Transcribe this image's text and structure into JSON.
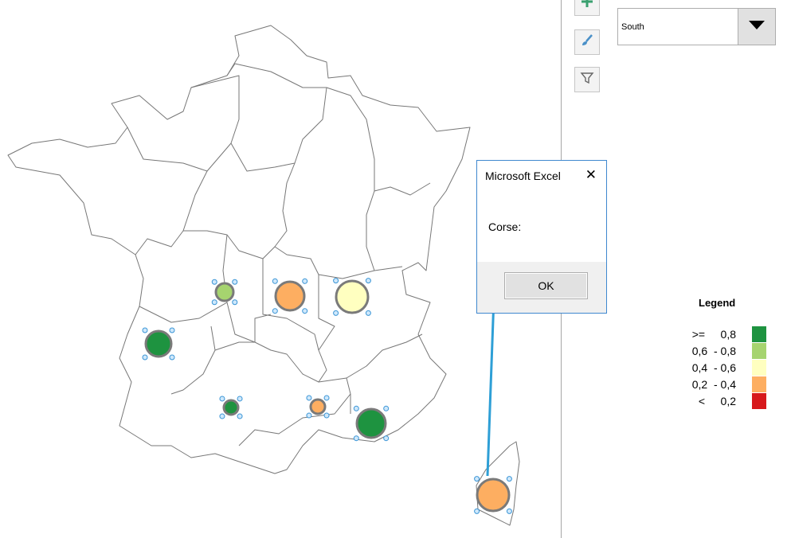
{
  "dropdown": {
    "selected": "South"
  },
  "toolbar": {
    "add": "plus-icon",
    "format": "paintbrush-icon",
    "filter": "filter-icon"
  },
  "dialog": {
    "title": "Microsoft Excel",
    "message": "Corse:",
    "ok_label": "OK"
  },
  "legend": {
    "title": "Legend",
    "items": [
      {
        "label": ">=     0,8",
        "color": "#1e9340"
      },
      {
        "label": "0,6  - 0,8",
        "color": "#a6d46f"
      },
      {
        "label": "0,4  - 0,6",
        "color": "#ffffc0"
      },
      {
        "label": "0,2  - 0,4",
        "color": "#fdae61"
      },
      {
        "label": "<     0,2",
        "color": "#d7191c"
      }
    ]
  },
  "markers": [
    {
      "region": "pays-de-la-loire",
      "color": "#a6d46f"
    },
    {
      "region": "centre",
      "color": "#fdae61"
    },
    {
      "region": "bourgogne",
      "color": "#ffffc0"
    },
    {
      "region": "aquitaine",
      "color": "#1e9340"
    },
    {
      "region": "midi-pyrenees",
      "color": "#1e9340"
    },
    {
      "region": "languedoc",
      "color": "#fdae61"
    },
    {
      "region": "paca",
      "color": "#1e9340"
    },
    {
      "region": "corse",
      "color": "#fdae61"
    }
  ],
  "colors": {
    "accent": "#2e9fd6",
    "dialog_border": "#3f88cf"
  }
}
